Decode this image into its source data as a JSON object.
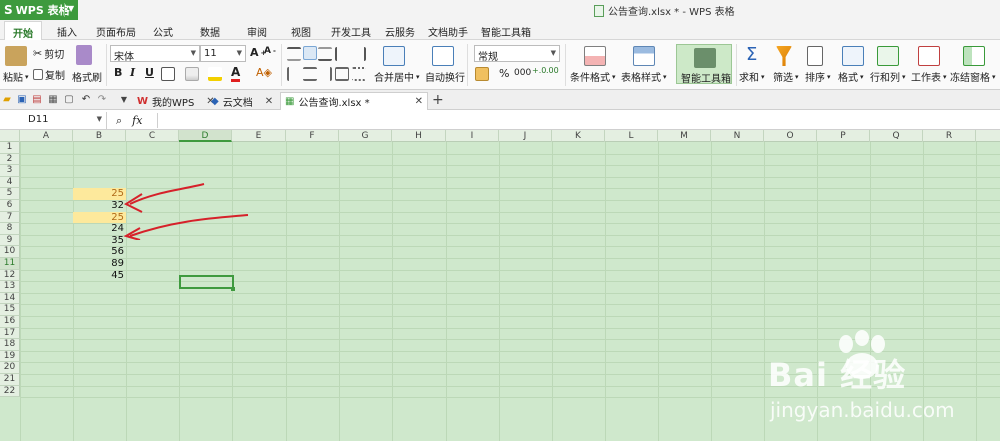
{
  "app": {
    "app_button_label": "WPS 表格",
    "window_title": "公告查询.xlsx * - WPS 表格"
  },
  "menu": {
    "tabs": [
      "开始",
      "插入",
      "页面布局",
      "公式",
      "数据",
      "审阅",
      "视图",
      "开发工具",
      "云服务",
      "文档助手",
      "智能工具箱"
    ],
    "active_index": 0
  },
  "ribbon": {
    "paste": "粘贴",
    "cut": "剪切",
    "copy": "复制",
    "format_painter": "格式刷",
    "font_name": "宋体",
    "font_size": "11",
    "bold": "B",
    "italic": "I",
    "underline": "U",
    "merge_center": "合并居中",
    "wrap_text": "自动换行",
    "number_format": "常规",
    "percent": "%",
    "thousands": "000",
    "conditional_format": "条件格式",
    "table_style": "表格样式",
    "smart_toolbox": "智能工具箱",
    "sum": "求和",
    "filter": "筛选",
    "sort": "排序",
    "format": "格式",
    "rows_cols": "行和列",
    "worksheet": "工作表",
    "freeze_panes": "冻结窗格"
  },
  "doc_tabs": [
    {
      "label": "我的WPS"
    },
    {
      "label": "云文档"
    },
    {
      "label": "公告查询.xlsx *"
    }
  ],
  "formula_bar": {
    "name_box": "D11",
    "fx_label": "fx",
    "formula": ""
  },
  "columns": [
    "A",
    "B",
    "C",
    "D",
    "E",
    "F",
    "G",
    "H",
    "I",
    "J",
    "K",
    "L",
    "M",
    "N",
    "O",
    "P",
    "Q",
    "R"
  ],
  "rows": [
    "1",
    "2",
    "3",
    "4",
    "5",
    "6",
    "7",
    "8",
    "9",
    "10",
    "11",
    "12",
    "13",
    "14",
    "15",
    "16",
    "17",
    "18",
    "19",
    "20",
    "21",
    "22"
  ],
  "cells": {
    "B5": "25",
    "B6": "32",
    "B7": "25",
    "B8": "24",
    "B9": "35",
    "B10": "56",
    "B11": "89",
    "B12": "45"
  },
  "selected_cell": "D11",
  "highlight_color": "#fde99c",
  "accent_color": "#3f9a3f",
  "watermark": {
    "brand": "Bai 经验",
    "url": "jingyan.baidu.com"
  }
}
